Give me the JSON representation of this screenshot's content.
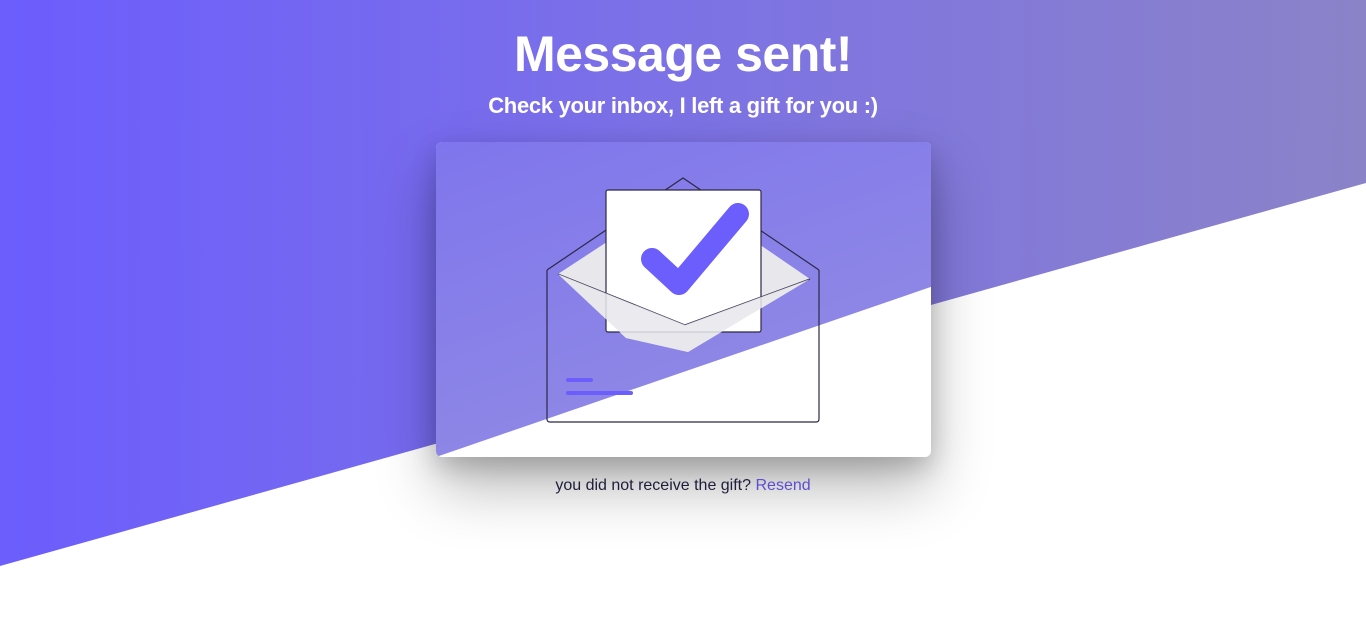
{
  "heading": {
    "title": "Message sent!",
    "subtitle": "Check your inbox, I left a gift for you :)"
  },
  "illustration": {
    "icon": "envelope-check-icon"
  },
  "footer": {
    "text": "you did not receive the gift?",
    "link_label": "Resend"
  },
  "colors": {
    "accent": "#6c5dfd",
    "link": "#5b4fd0",
    "text": "#1f1d3a",
    "background": "#ffffff"
  }
}
